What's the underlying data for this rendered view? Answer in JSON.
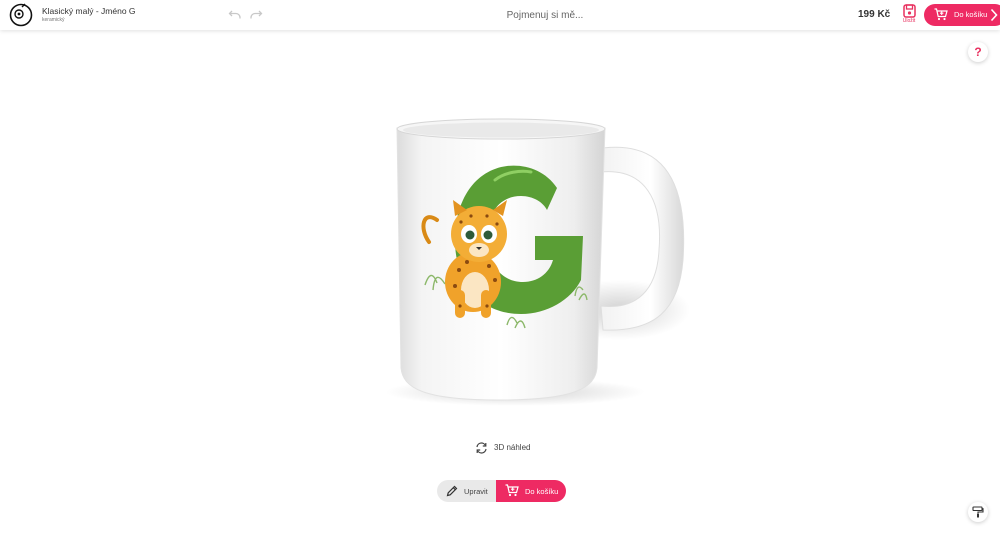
{
  "header": {
    "product_title": "Klasický malý - Jméno G",
    "product_subtitle": "keramický",
    "name_placeholder": "Pojmenuj si mě...",
    "price": "199 Kč",
    "save_label": "Uložit",
    "cart_label": "Do košíku"
  },
  "preview": {
    "label_3d": "3D náhled"
  },
  "actions": {
    "edit_label": "Upravit",
    "cart_label": "Do košíku"
  },
  "colors": {
    "accent": "#ee2a63",
    "letter_green": "#5a9e35"
  },
  "icons": [
    "logo-icon",
    "undo-icon",
    "redo-icon",
    "save-icon",
    "cart-icon",
    "chevron-right-icon",
    "help-icon",
    "paint-roller-icon",
    "rotate-3d-icon",
    "pencil-icon"
  ]
}
